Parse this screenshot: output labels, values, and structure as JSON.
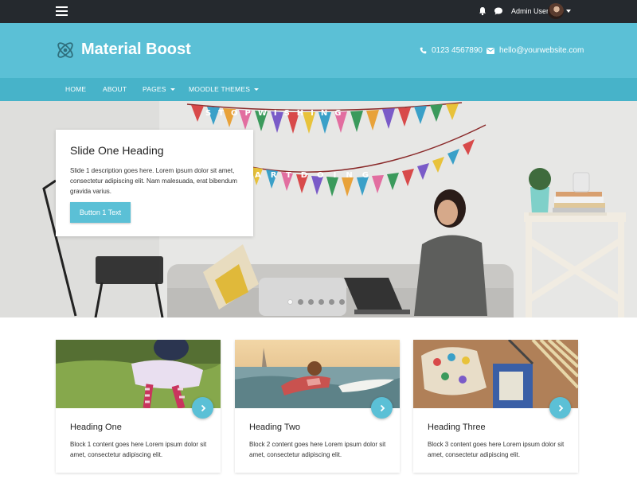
{
  "topbar": {
    "user_name": "Admin User",
    "icons": [
      "hamburger-menu-icon",
      "bell-icon",
      "chat-bubble-icon",
      "avatar",
      "chevron-down-icon"
    ]
  },
  "header": {
    "site_title": "Material Boost",
    "phone": "0123 4567890",
    "email": "hello@yourwebsite.com",
    "icons": [
      "atom-icon",
      "phone-icon",
      "envelope-icon"
    ]
  },
  "nav": {
    "items": [
      {
        "label": "HOME"
      },
      {
        "label": "ABOUT"
      },
      {
        "label": "PAGES"
      },
      {
        "label": "MOODLE THEMES"
      }
    ]
  },
  "hero": {
    "heading": "Slide One Heading",
    "description": "Slide 1 description goes here. Lorem ipsum dolor sit amet, consectetur adipiscing elit. Nam malesuada, erat bibendum gravida varius.",
    "button_label": "Button 1 Text",
    "slide_count": 6,
    "active_slide": 1,
    "banner_text_top": "STOPWISHING",
    "banner_text_bottom": "ARTDOING"
  },
  "cards": [
    {
      "heading": "Heading One",
      "text": "Block 1 content goes here Lorem ipsum dolor sit amet, consectetur adipiscing elit."
    },
    {
      "heading": "Heading Two",
      "text": "Block 2 content goes here Lorem ipsum dolor sit amet, consectetur adipiscing elit."
    },
    {
      "heading": "Heading Three",
      "text": "Block 3 content goes here Lorem ipsum dolor sit amet, consectetur adipiscing elit."
    }
  ],
  "colors": {
    "topbar": "#25292e",
    "header": "#5bc0d6",
    "nav": "#47b3c9",
    "accent": "#5bc0d6"
  }
}
